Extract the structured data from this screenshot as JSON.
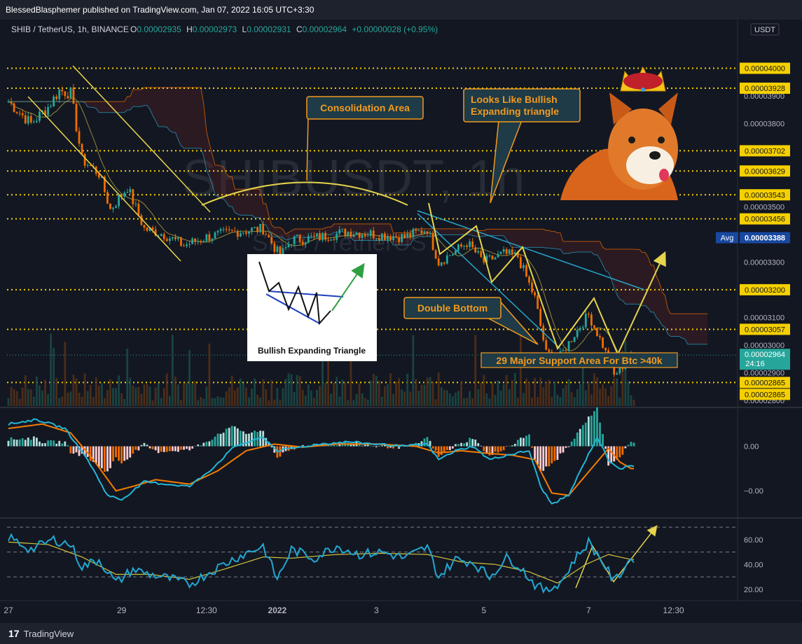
{
  "header": {
    "published_line": "BlessedBlasphemer published on TradingView.com, Jan 07, 2022 16:05 UTC+3:30"
  },
  "legend": {
    "symbol": "SHIB / TetherUS, 1h, BINANCE",
    "o_label": "O",
    "o_value": "0.00002935",
    "h_label": "H",
    "h_value": "0.00002973",
    "l_label": "L",
    "l_value": "0.00002931",
    "c_label": "C",
    "c_value": "0.00002964",
    "change": "+0.00000028 (+0.95%)"
  },
  "currency_button": "USDT",
  "watermark": {
    "ticker": "SHIBUSDT, 1h",
    "pair": "SHIB / TetherUS"
  },
  "footer": {
    "brand": "TradingView",
    "logo_glyph": "17"
  },
  "colors": {
    "background": "#131722",
    "up": "#26a69a",
    "down": "#ef6c00",
    "annotation_orange": "#f29a1f",
    "annotation_box": "#1e3b47",
    "yellow_level": "#f5d000",
    "trend_yellow": "#e5d44c",
    "trend_blue": "#26a6c8",
    "macd_line": "#24b6d8",
    "signal_line": "#f57c00",
    "rsi_line": "#22a7d1",
    "rsi_ma": "#d4c43c"
  },
  "annotations": {
    "consolidation": "Consolidation Area",
    "bullish_line1": "Looks Like Bullish",
    "bullish_line2": "Expanding triangle",
    "double_bottom": "Double Bottom",
    "support": "29 Major Support Area For Btc >40k",
    "inset_caption": "Bullish Expanding Triangle"
  },
  "chart_data": [
    {
      "type": "candlestick",
      "title": "SHIB / TetherUS, 1h, BINANCE",
      "x_tick_labels": [
        "27",
        "29",
        "12:30",
        "2022",
        "3",
        "5",
        "7",
        "12:30"
      ],
      "x_tick_index": [
        0,
        40,
        70,
        95,
        130,
        168,
        205,
        235
      ],
      "ylim": [
        2.78e-05,
        4.1e-05
      ],
      "y_tick_labels": [
        "0.00003900",
        "0.00003800",
        "0.00003500",
        "0.00003300",
        "0.00003100",
        "0.00003000",
        "0.00002900",
        "0.00002800"
      ],
      "y_tick_values": [
        3.9e-05,
        3.8e-05,
        3.5e-05,
        3.3e-05,
        3.1e-05,
        3e-05,
        2.9e-05,
        2.8e-05
      ],
      "levels": [
        4e-05,
        3.928e-05,
        3.702e-05,
        3.629e-05,
        3.543e-05,
        3.456e-05,
        3.2e-05,
        3.057e-05,
        2.865e-05
      ],
      "level_labels": [
        "0.00004000",
        "0.00003928",
        "0.00003702",
        "0.00003629",
        "0.00003543",
        "0.00003456",
        "0.00003200",
        "0.00003057",
        "0.00002865",
        "0.00002865"
      ],
      "avg_label": "Avg",
      "avg_value": 3.388e-05,
      "avg_value_label": "0.00003388",
      "last_price": 2.964e-05,
      "last_price_label": "0.00002964",
      "countdown": "24:16",
      "close_anchors": [
        [
          0,
          3.88e-05
        ],
        [
          8,
          3.8e-05
        ],
        [
          14,
          3.86e-05
        ],
        [
          18,
          3.92e-05
        ],
        [
          22,
          3.91e-05
        ],
        [
          26,
          3.67e-05
        ],
        [
          32,
          3.62e-05
        ],
        [
          36,
          3.49e-05
        ],
        [
          42,
          3.57e-05
        ],
        [
          48,
          3.42e-05
        ],
        [
          55,
          3.4e-05
        ],
        [
          62,
          3.36e-05
        ],
        [
          70,
          3.39e-05
        ],
        [
          80,
          3.41e-05
        ],
        [
          90,
          3.42e-05
        ],
        [
          96,
          3.32e-05
        ],
        [
          100,
          3.38e-05
        ],
        [
          110,
          3.39e-05
        ],
        [
          120,
          3.41e-05
        ],
        [
          130,
          3.4e-05
        ],
        [
          140,
          3.39e-05
        ],
        [
          148,
          3.42e-05
        ],
        [
          152,
          3.3e-05
        ],
        [
          158,
          3.34e-05
        ],
        [
          162,
          3.37e-05
        ],
        [
          168,
          3.3e-05
        ],
        [
          175,
          3.33e-05
        ],
        [
          180,
          3.32e-05
        ],
        [
          186,
          3.17e-05
        ],
        [
          190,
          2.97e-05
        ],
        [
          195,
          2.96e-05
        ],
        [
          200,
          3.04e-05
        ],
        [
          205,
          3.11e-05
        ],
        [
          210,
          3e-05
        ],
        [
          214,
          2.89e-05
        ],
        [
          220,
          2.96e-05
        ]
      ]
    },
    {
      "type": "line",
      "name": "MACD",
      "y_tick_labels": [
        "0.00",
        "−0.00"
      ],
      "y_tick_values": [
        0,
        -1
      ],
      "ylim": [
        -1.5,
        0.7
      ],
      "macd_anchors": [
        [
          0,
          0.5
        ],
        [
          10,
          0.6
        ],
        [
          20,
          0.4
        ],
        [
          28,
          -0.3
        ],
        [
          35,
          -1.1
        ],
        [
          40,
          -1.2
        ],
        [
          48,
          -0.8
        ],
        [
          56,
          -0.85
        ],
        [
          64,
          -0.9
        ],
        [
          72,
          -0.5
        ],
        [
          80,
          0.0
        ],
        [
          90,
          0.2
        ],
        [
          95,
          -0.1
        ],
        [
          100,
          -0.05
        ],
        [
          110,
          0.05
        ],
        [
          120,
          0.1
        ],
        [
          130,
          0.05
        ],
        [
          140,
          0.0
        ],
        [
          148,
          0.05
        ],
        [
          152,
          -0.3
        ],
        [
          158,
          -0.1
        ],
        [
          164,
          0.0
        ],
        [
          170,
          -0.3
        ],
        [
          176,
          -0.2
        ],
        [
          184,
          -0.1
        ],
        [
          188,
          -0.9
        ],
        [
          192,
          -1.3
        ],
        [
          198,
          -1.1
        ],
        [
          204,
          -0.3
        ],
        [
          208,
          0.2
        ],
        [
          212,
          -0.3
        ],
        [
          216,
          -0.5
        ],
        [
          220,
          -0.45
        ]
      ],
      "signal_anchors": [
        [
          0,
          0.4
        ],
        [
          12,
          0.5
        ],
        [
          22,
          0.3
        ],
        [
          30,
          -0.3
        ],
        [
          38,
          -1.0
        ],
        [
          44,
          -0.9
        ],
        [
          52,
          -0.75
        ],
        [
          64,
          -0.85
        ],
        [
          74,
          -0.55
        ],
        [
          84,
          -0.1
        ],
        [
          94,
          0.05
        ],
        [
          104,
          -0.02
        ],
        [
          116,
          0.05
        ],
        [
          130,
          0.05
        ],
        [
          144,
          0.0
        ],
        [
          152,
          -0.15
        ],
        [
          160,
          -0.1
        ],
        [
          168,
          -0.15
        ],
        [
          178,
          -0.2
        ],
        [
          186,
          -0.3
        ],
        [
          192,
          -1.05
        ],
        [
          198,
          -1.1
        ],
        [
          206,
          -0.5
        ],
        [
          212,
          -0.05
        ],
        [
          216,
          -0.35
        ],
        [
          220,
          -0.5
        ]
      ]
    },
    {
      "type": "line",
      "name": "RSI",
      "y_tick_labels": [
        "60.00",
        "40.00",
        "20.00"
      ],
      "y_tick_values": [
        60,
        40,
        20
      ],
      "ylim": [
        12,
        74
      ],
      "band_levels": [
        70,
        50,
        30
      ],
      "rsi_anchors": [
        [
          0,
          62
        ],
        [
          8,
          52
        ],
        [
          16,
          60
        ],
        [
          22,
          56
        ],
        [
          26,
          38
        ],
        [
          32,
          44
        ],
        [
          38,
          25
        ],
        [
          44,
          36
        ],
        [
          50,
          32
        ],
        [
          58,
          28
        ],
        [
          64,
          24
        ],
        [
          72,
          35
        ],
        [
          80,
          45
        ],
        [
          90,
          55
        ],
        [
          95,
          28
        ],
        [
          100,
          52
        ],
        [
          108,
          45
        ],
        [
          116,
          55
        ],
        [
          124,
          48
        ],
        [
          132,
          50
        ],
        [
          140,
          45
        ],
        [
          148,
          54
        ],
        [
          152,
          30
        ],
        [
          158,
          44
        ],
        [
          164,
          42
        ],
        [
          170,
          30
        ],
        [
          176,
          45
        ],
        [
          180,
          40
        ],
        [
          186,
          24
        ],
        [
          190,
          18
        ],
        [
          196,
          28
        ],
        [
          200,
          44
        ],
        [
          205,
          58
        ],
        [
          210,
          42
        ],
        [
          214,
          26
        ],
        [
          220,
          45
        ]
      ],
      "rsi_ma_anchors": [
        [
          0,
          58
        ],
        [
          14,
          56
        ],
        [
          26,
          46
        ],
        [
          38,
          32
        ],
        [
          50,
          32
        ],
        [
          64,
          28
        ],
        [
          76,
          36
        ],
        [
          90,
          46
        ],
        [
          100,
          45
        ],
        [
          116,
          48
        ],
        [
          132,
          49
        ],
        [
          148,
          48
        ],
        [
          160,
          42
        ],
        [
          172,
          40
        ],
        [
          184,
          34
        ],
        [
          194,
          25
        ],
        [
          204,
          40
        ],
        [
          212,
          48
        ],
        [
          220,
          44
        ]
      ]
    }
  ]
}
